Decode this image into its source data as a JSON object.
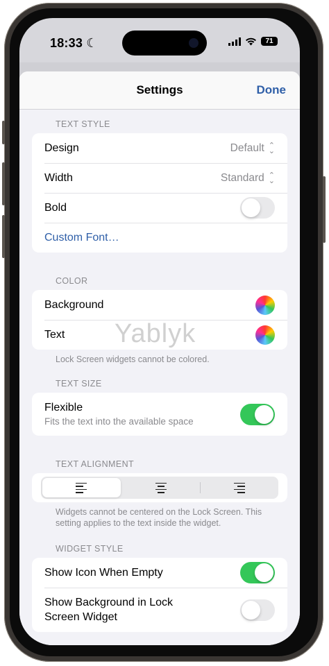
{
  "status": {
    "time": "18:33",
    "battery": "71"
  },
  "nav": {
    "title": "Settings",
    "done": "Done"
  },
  "text_style": {
    "header": "TEXT STYLE",
    "design_label": "Default",
    "design_title": "Design",
    "width_title": "Width",
    "width_value": "Standard",
    "bold_title": "Bold",
    "bold_on": false,
    "custom_font": "Custom Font…"
  },
  "color": {
    "header": "COLOR",
    "background": "Background",
    "text": "Text",
    "footer": "Lock Screen widgets cannot be colored."
  },
  "text_size": {
    "header": "TEXT SIZE",
    "flexible": "Flexible",
    "flexible_sub": "Fits the text into the available space",
    "flexible_on": true
  },
  "text_alignment": {
    "header": "TEXT ALIGNMENT",
    "options": [
      "left-align-icon",
      "center-align-icon",
      "right-align-icon"
    ],
    "selected": "left",
    "footer": "Widgets cannot be centered on the Lock Screen. This setting applies to the text inside the widget."
  },
  "widget_style": {
    "header": "WIDGET STYLE",
    "show_icon": "Show Icon When Empty",
    "show_icon_on": true,
    "show_bg": "Show Background in Lock Screen Widget",
    "show_bg_on": false
  },
  "watermark": "Yablyk",
  "colors": {
    "accent": "#2f5fa8",
    "toggle_on": "#34c759",
    "secondary_text": "#8a8a8e"
  }
}
